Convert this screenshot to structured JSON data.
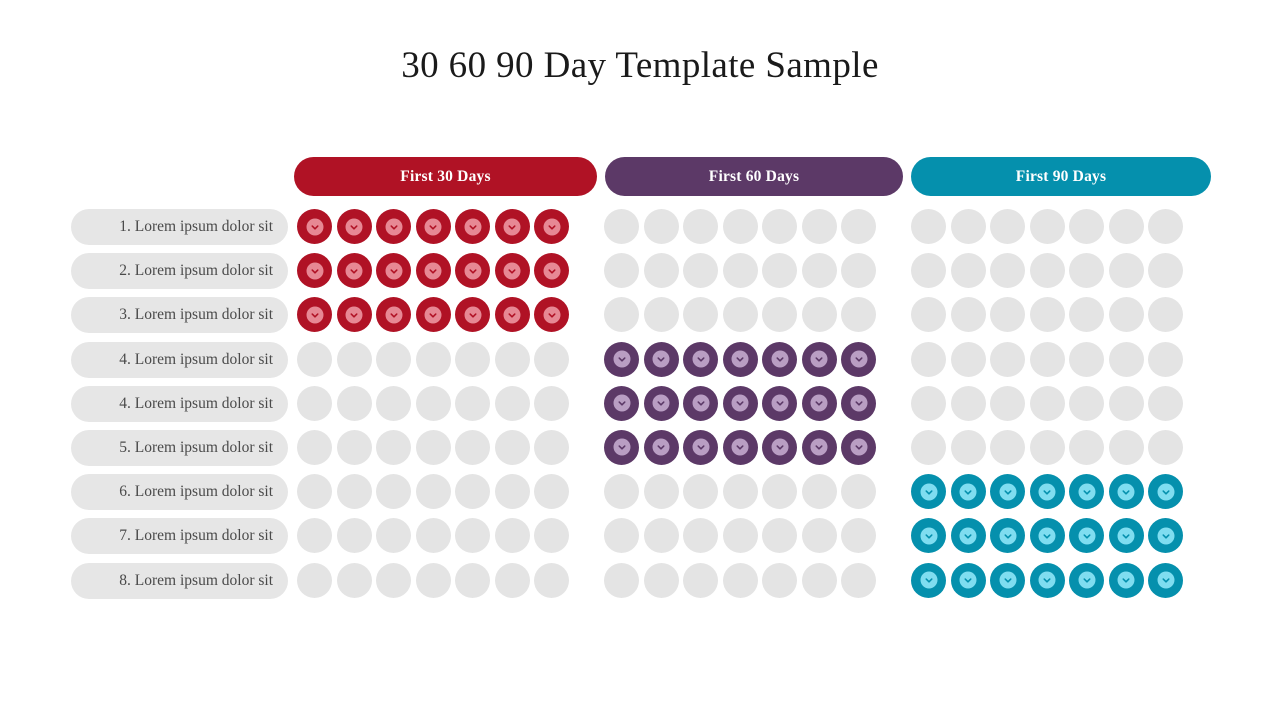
{
  "slide": {
    "background_color": "#ffffff",
    "title": "30 60 90 Day Template Sample"
  },
  "phases": [
    {
      "label": "First 30 Days",
      "color": "#b01225",
      "inner_color": "#e78894",
      "icon": "check-circle-icon"
    },
    {
      "label": "First 60 Days",
      "color": "#5c3967",
      "inner_color": "#b99ec3",
      "icon": "check-circle-icon"
    },
    {
      "label": "First 90 Days",
      "color": "#0590ad",
      "inner_color": "#7fddf0",
      "icon": "check-circle-icon"
    }
  ],
  "empty_cell_color": "#e4e4e4",
  "row_label_pill_color": "#e6e6e6",
  "columns_per_phase": 7,
  "rows": [
    {
      "label": "1. Lorem ipsum dolor sit",
      "filled": [
        true,
        false,
        false
      ]
    },
    {
      "label": "2. Lorem ipsum dolor sit",
      "filled": [
        true,
        false,
        false
      ]
    },
    {
      "label": "3. Lorem ipsum dolor sit",
      "filled": [
        true,
        false,
        false
      ]
    },
    {
      "label": "4. Lorem ipsum dolor sit",
      "filled": [
        false,
        true,
        false
      ]
    },
    {
      "label": "4. Lorem ipsum dolor sit",
      "filled": [
        false,
        true,
        false
      ]
    },
    {
      "label": "5. Lorem ipsum dolor sit",
      "filled": [
        false,
        true,
        false
      ]
    },
    {
      "label": "6. Lorem ipsum dolor sit",
      "filled": [
        false,
        false,
        true
      ]
    },
    {
      "label": "7. Lorem ipsum dolor sit",
      "filled": [
        false,
        false,
        true
      ]
    },
    {
      "label": "8. Lorem ipsum dolor sit",
      "filled": [
        false,
        false,
        true
      ]
    }
  ]
}
